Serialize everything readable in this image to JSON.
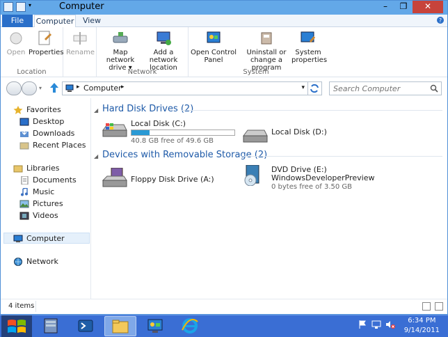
{
  "window": {
    "title": "Computer"
  },
  "tabs": {
    "file": "File",
    "computer": "Computer",
    "view": "View"
  },
  "ribbon": {
    "groups": {
      "location": "Location",
      "network": "Network",
      "system": "System"
    },
    "buttons": {
      "properties": "Properties",
      "open": "Open",
      "rename": "Rename",
      "map_network_drive": [
        "Map network",
        "drive ▾"
      ],
      "add_network_location": [
        "Add a network",
        "location"
      ],
      "open_control_panel": [
        "Open Control",
        "Panel"
      ],
      "uninstall": [
        "Uninstall or",
        "change a program"
      ],
      "system_properties": [
        "System",
        "properties"
      ]
    }
  },
  "address": {
    "crumb": "Computer",
    "separator": "▸",
    "search_placeholder": "Search Computer"
  },
  "nav": {
    "favorites": "Favorites",
    "desktop": "Desktop",
    "downloads": "Downloads",
    "recent_places": "Recent Places",
    "libraries": "Libraries",
    "documents": "Documents",
    "music": "Music",
    "pictures": "Pictures",
    "videos": "Videos",
    "computer": "Computer",
    "network": "Network"
  },
  "sections": {
    "hard_disks": "Hard Disk Drives (2)",
    "removable": "Devices with Removable Storage (2)"
  },
  "drives": {
    "c": {
      "name": "Local Disk (C:)",
      "free": "40.8 GB free of 49.6 GB",
      "used_fraction": 0.177
    },
    "d": {
      "name": "Local Disk (D:)"
    },
    "a": {
      "name": "Floppy Disk Drive (A:)"
    },
    "e": {
      "name": "DVD Drive (E:)",
      "label": "WindowsDeveloperPreview",
      "free": "0 bytes free of 3.50 GB"
    }
  },
  "status": {
    "item_count": "4 items"
  },
  "clock": {
    "time": "6:34 PM",
    "date": "9/14/2011"
  },
  "colors": {
    "accent": "#1e5aa8",
    "progress": "#2a9ad5",
    "taskbar": "#3a6ed4"
  }
}
